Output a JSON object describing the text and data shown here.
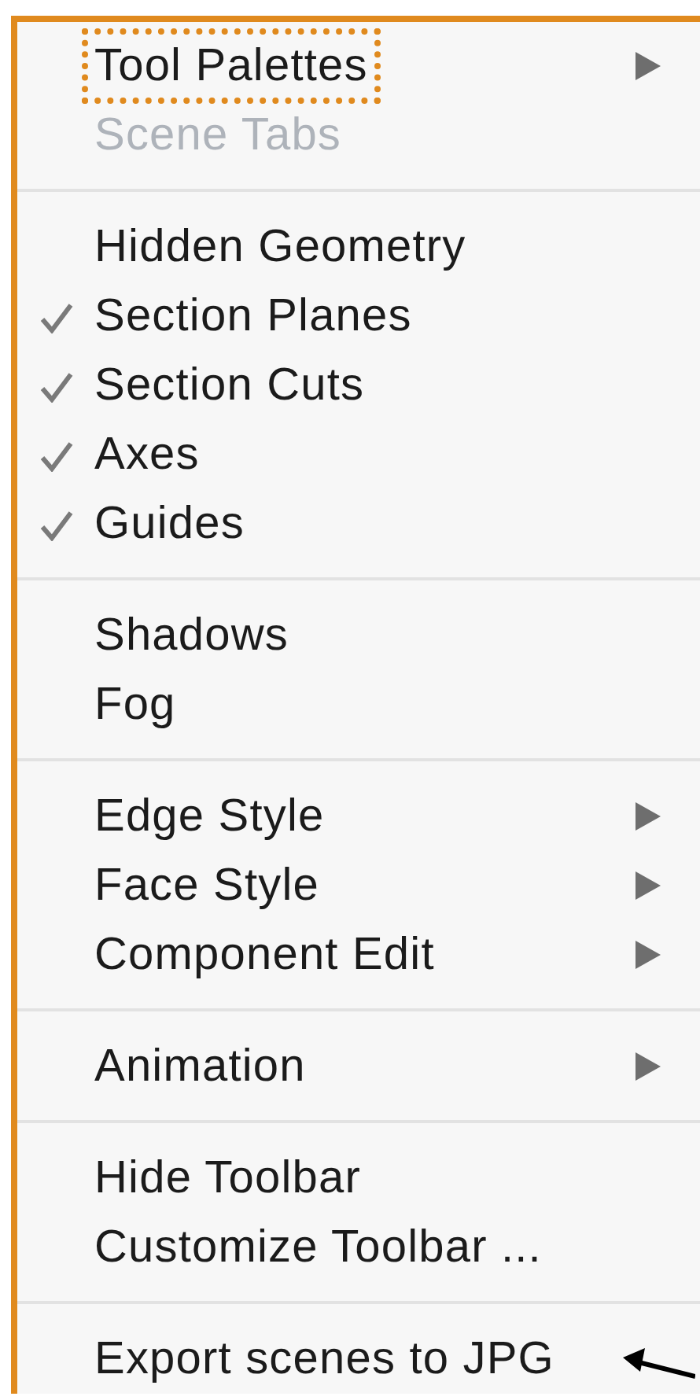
{
  "menu": {
    "groups": [
      {
        "items": [
          {
            "label": "Tool Palettes",
            "checked": false,
            "disabled": false,
            "submenu": true,
            "outlined": true,
            "arrow_pointer": false
          },
          {
            "label": "Scene Tabs",
            "checked": false,
            "disabled": true,
            "submenu": false,
            "outlined": false,
            "arrow_pointer": false
          }
        ]
      },
      {
        "items": [
          {
            "label": "Hidden Geometry",
            "checked": false,
            "disabled": false,
            "submenu": false,
            "outlined": false,
            "arrow_pointer": false
          },
          {
            "label": "Section Planes",
            "checked": true,
            "disabled": false,
            "submenu": false,
            "outlined": false,
            "arrow_pointer": false
          },
          {
            "label": "Section Cuts",
            "checked": true,
            "disabled": false,
            "submenu": false,
            "outlined": false,
            "arrow_pointer": false
          },
          {
            "label": "Axes",
            "checked": true,
            "disabled": false,
            "submenu": false,
            "outlined": false,
            "arrow_pointer": false
          },
          {
            "label": "Guides",
            "checked": true,
            "disabled": false,
            "submenu": false,
            "outlined": false,
            "arrow_pointer": false
          }
        ]
      },
      {
        "items": [
          {
            "label": "Shadows",
            "checked": false,
            "disabled": false,
            "submenu": false,
            "outlined": false,
            "arrow_pointer": false
          },
          {
            "label": "Fog",
            "checked": false,
            "disabled": false,
            "submenu": false,
            "outlined": false,
            "arrow_pointer": false
          }
        ]
      },
      {
        "items": [
          {
            "label": "Edge Style",
            "checked": false,
            "disabled": false,
            "submenu": true,
            "outlined": false,
            "arrow_pointer": false
          },
          {
            "label": "Face Style",
            "checked": false,
            "disabled": false,
            "submenu": true,
            "outlined": false,
            "arrow_pointer": false
          },
          {
            "label": "Component Edit",
            "checked": false,
            "disabled": false,
            "submenu": true,
            "outlined": false,
            "arrow_pointer": false
          }
        ]
      },
      {
        "items": [
          {
            "label": "Animation",
            "checked": false,
            "disabled": false,
            "submenu": true,
            "outlined": false,
            "arrow_pointer": false
          }
        ]
      },
      {
        "items": [
          {
            "label": "Hide Toolbar",
            "checked": false,
            "disabled": false,
            "submenu": false,
            "outlined": false,
            "arrow_pointer": false
          },
          {
            "label": "Customize Toolbar ...",
            "checked": false,
            "disabled": false,
            "submenu": false,
            "outlined": false,
            "arrow_pointer": false
          }
        ]
      },
      {
        "items": [
          {
            "label": "Export scenes to JPG",
            "checked": false,
            "disabled": false,
            "submenu": false,
            "outlined": false,
            "arrow_pointer": true
          }
        ]
      }
    ]
  }
}
